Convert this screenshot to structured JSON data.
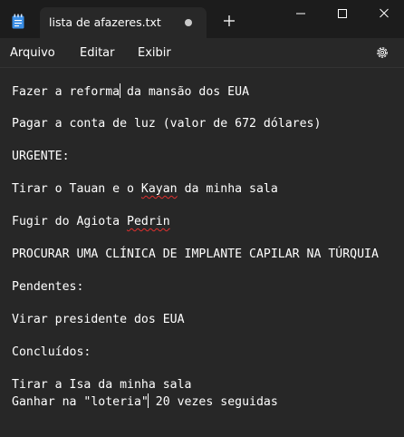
{
  "window": {
    "tab_title": "lista de afazeres.txt"
  },
  "menu": {
    "file": "Arquivo",
    "edit": "Editar",
    "view": "Exibir"
  },
  "editor": {
    "lines": {
      "l1a": "Fazer a reforma",
      "l1b": " da mansão dos EUA",
      "l2": "Pagar a conta de luz (valor de 672 dólares)",
      "l3": "URGENTE:",
      "l4a": "Tirar o Tauan e o ",
      "l4b": "Kayan",
      "l4c": " da minha sala",
      "l5a": "Fugir do Agiota ",
      "l5b": "Pedrin",
      "l6": "PROCURAR UMA CLÍNICA DE IMPLANTE CAPILAR NA TÚRQUIA",
      "l7": "Pendentes:",
      "l8": "Virar presidente dos EUA",
      "l9": "Concluídos:",
      "l10": "Tirar a Isa da minha sala",
      "l11a": "Ganhar na \"loteria\"",
      "l11b": " 20 vezes seguidas"
    }
  },
  "icons": {
    "app": "notepad-icon",
    "unsaved": "unsaved-dot-icon",
    "new_tab": "plus-icon",
    "minimize": "minimize-icon",
    "maximize": "maximize-icon",
    "close": "close-icon",
    "settings": "gear-icon"
  },
  "colors": {
    "titlebar_bg": "#1c1c1c",
    "menubar_bg": "#282828",
    "editor_bg": "#272727",
    "spellcheck": "#e0302f",
    "app_icon": "#3a8ee6"
  }
}
